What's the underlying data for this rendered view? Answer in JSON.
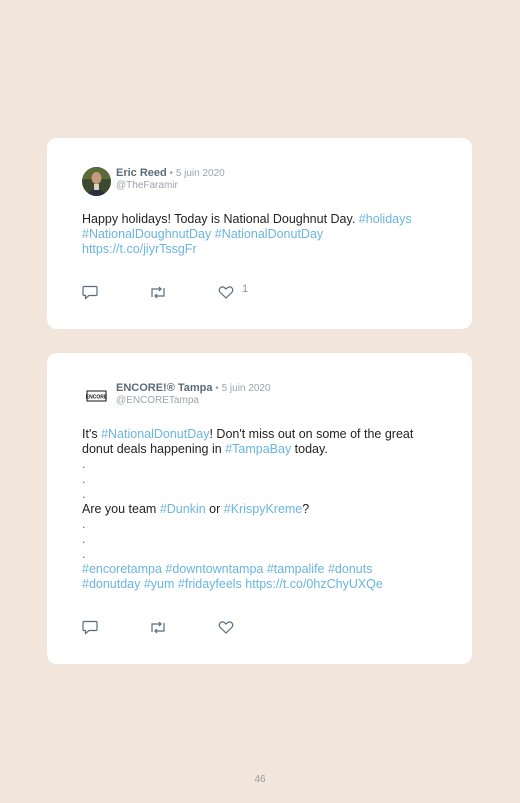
{
  "tweets": [
    {
      "name": "Eric Reed",
      "sep": " • ",
      "date": "5 juin 2020",
      "handle": "@TheFaramir",
      "line1_text": "Happy holidays! Today is National Doughnut Day. ",
      "line1_tag": "#holidays",
      "line2_tag1": "#NationalDoughnutDay",
      "line2_sp": " ",
      "line2_tag2": "#NationalDonutDay",
      "line3_link": "https://t.co/jiyrTssgFr",
      "like_count": "1"
    },
    {
      "name": "ENCORE!® Tampa",
      "sep": " • ",
      "date": "5 juin 2020",
      "handle": "@ENCORETampa",
      "p1_a": "It's ",
      "p1_tag": "#NationalDonutDay",
      "p1_b": "! Don't miss out on some of the great",
      "p2_a": "donut deals happening in ",
      "p2_tag": "#TampaBay",
      "p2_b": " today.",
      "dot": ".",
      "q_a": "Are you team ",
      "q_tag1": "#Dunkin",
      "q_or": " or ",
      "q_tag2": "#KrispyKreme",
      "q_end": "?",
      "tags_line1": "#encoretampa #downtowntampa #tampalife #donuts",
      "tags_line2_a": "#donutday #yum #fridayfeels ",
      "tags_line2_link": "https://t.co/0hzChyUXQe",
      "avatar_text": "ENCORE"
    }
  ],
  "page_number": "46",
  "colors": {
    "link": "#6ab5e0",
    "background": "#f2e6dc",
    "card": "#ffffff"
  }
}
